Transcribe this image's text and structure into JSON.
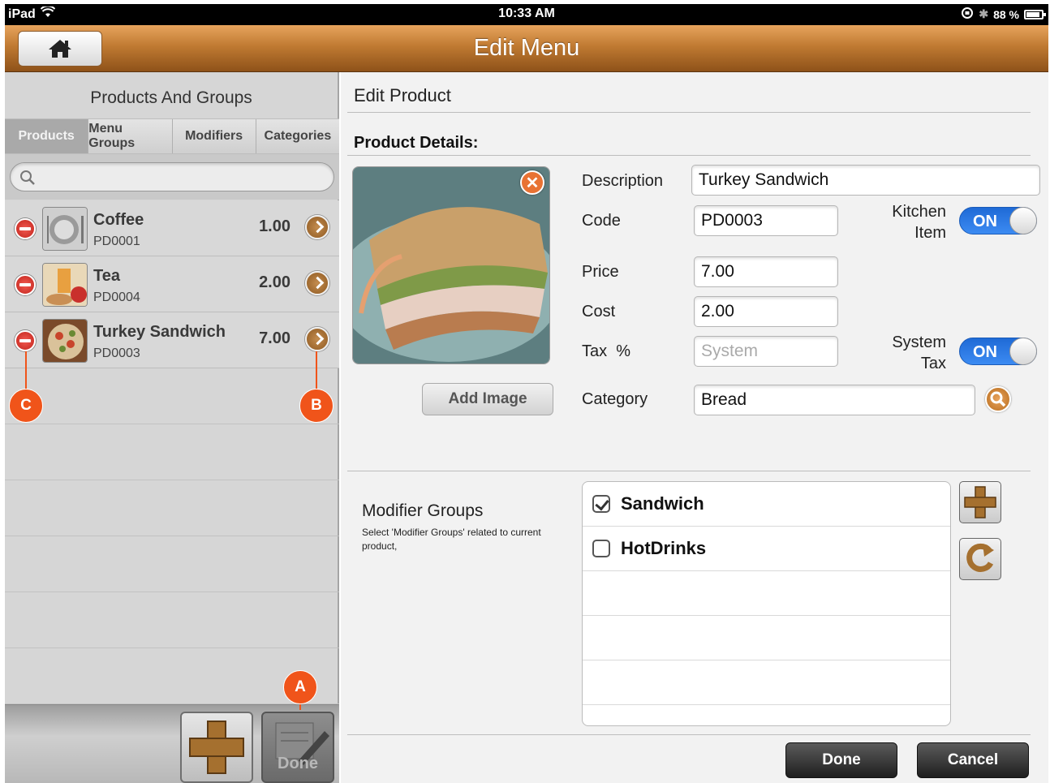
{
  "status_bar": {
    "device": "iPad",
    "time": "10:33 AM",
    "battery": "88 %"
  },
  "nav": {
    "title": "Edit Menu"
  },
  "left": {
    "title": "Products And Groups",
    "tabs": [
      "Products",
      "Menu Groups",
      "Modifiers",
      "Categories"
    ],
    "active_tab": "Products",
    "search_placeholder": "",
    "products": [
      {
        "name": "Coffee",
        "code": "PD0001",
        "price": "1.00"
      },
      {
        "name": "Tea",
        "code": "PD0004",
        "price": "2.00"
      },
      {
        "name": "Turkey Sandwich",
        "code": "PD0003",
        "price": "7.00"
      }
    ],
    "done_label": "Done"
  },
  "callouts": {
    "a": "A",
    "b": "B",
    "c": "C"
  },
  "right": {
    "title": "Edit Product",
    "details_heading": "Product Details:",
    "add_image_label": "Add Image",
    "labels": {
      "description": "Description",
      "code": "Code",
      "price": "Price",
      "cost": "Cost",
      "tax": "Tax  %",
      "category": "Category",
      "kitchen_item_1": "Kitchen",
      "kitchen_item_2": "Item",
      "system_tax_1": "System",
      "system_tax_2": "Tax"
    },
    "values": {
      "description": "Turkey Sandwich",
      "code": "PD0003",
      "price": "7.00",
      "cost": "2.00",
      "tax_placeholder": "System",
      "category": "Bread"
    },
    "kitchen_item_toggle": "ON",
    "system_tax_toggle": "ON",
    "modifier_groups": {
      "title": "Modifier Groups",
      "description": "Select 'Modifier Groups' related to current product,",
      "items": [
        {
          "name": "Sandwich",
          "checked": true
        },
        {
          "name": "HotDrinks",
          "checked": false
        }
      ]
    },
    "buttons": {
      "done": "Done",
      "cancel": "Cancel"
    }
  },
  "colors": {
    "nav_brown": "#c07a32",
    "toggle_blue": "#1f6ad6",
    "callout_orange": "#f0541a"
  }
}
